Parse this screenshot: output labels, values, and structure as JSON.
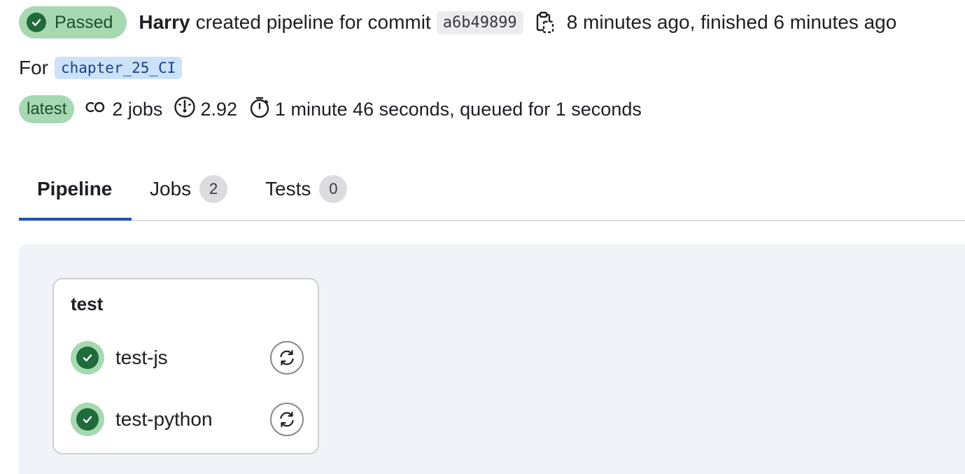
{
  "header": {
    "status_label": "Passed",
    "author": "Harry",
    "description": "created pipeline for commit",
    "commit_sha": "a6b49899",
    "time_info": "8 minutes ago, finished 6 minutes ago",
    "for_label": "For",
    "branch": "chapter_25_CI"
  },
  "meta": {
    "latest_label": "latest",
    "jobs_count": "2 jobs",
    "compute": "2.92",
    "duration": "1 minute 46 seconds, queued for 1 seconds"
  },
  "tabs": [
    {
      "label": "Pipeline",
      "active": true
    },
    {
      "label": "Jobs",
      "count": "2"
    },
    {
      "label": "Tests",
      "count": "0"
    }
  ],
  "stage": {
    "title": "test",
    "jobs": [
      {
        "name": "test-js",
        "status": "passed"
      },
      {
        "name": "test-python",
        "status": "passed"
      }
    ]
  },
  "colors": {
    "success_bg": "#a6d8b1",
    "success_icon": "#1f6b3a",
    "tab_underline": "#1f54b5",
    "branch_bg": "#cbe2f9",
    "graph_bg": "#f1f3f9"
  }
}
